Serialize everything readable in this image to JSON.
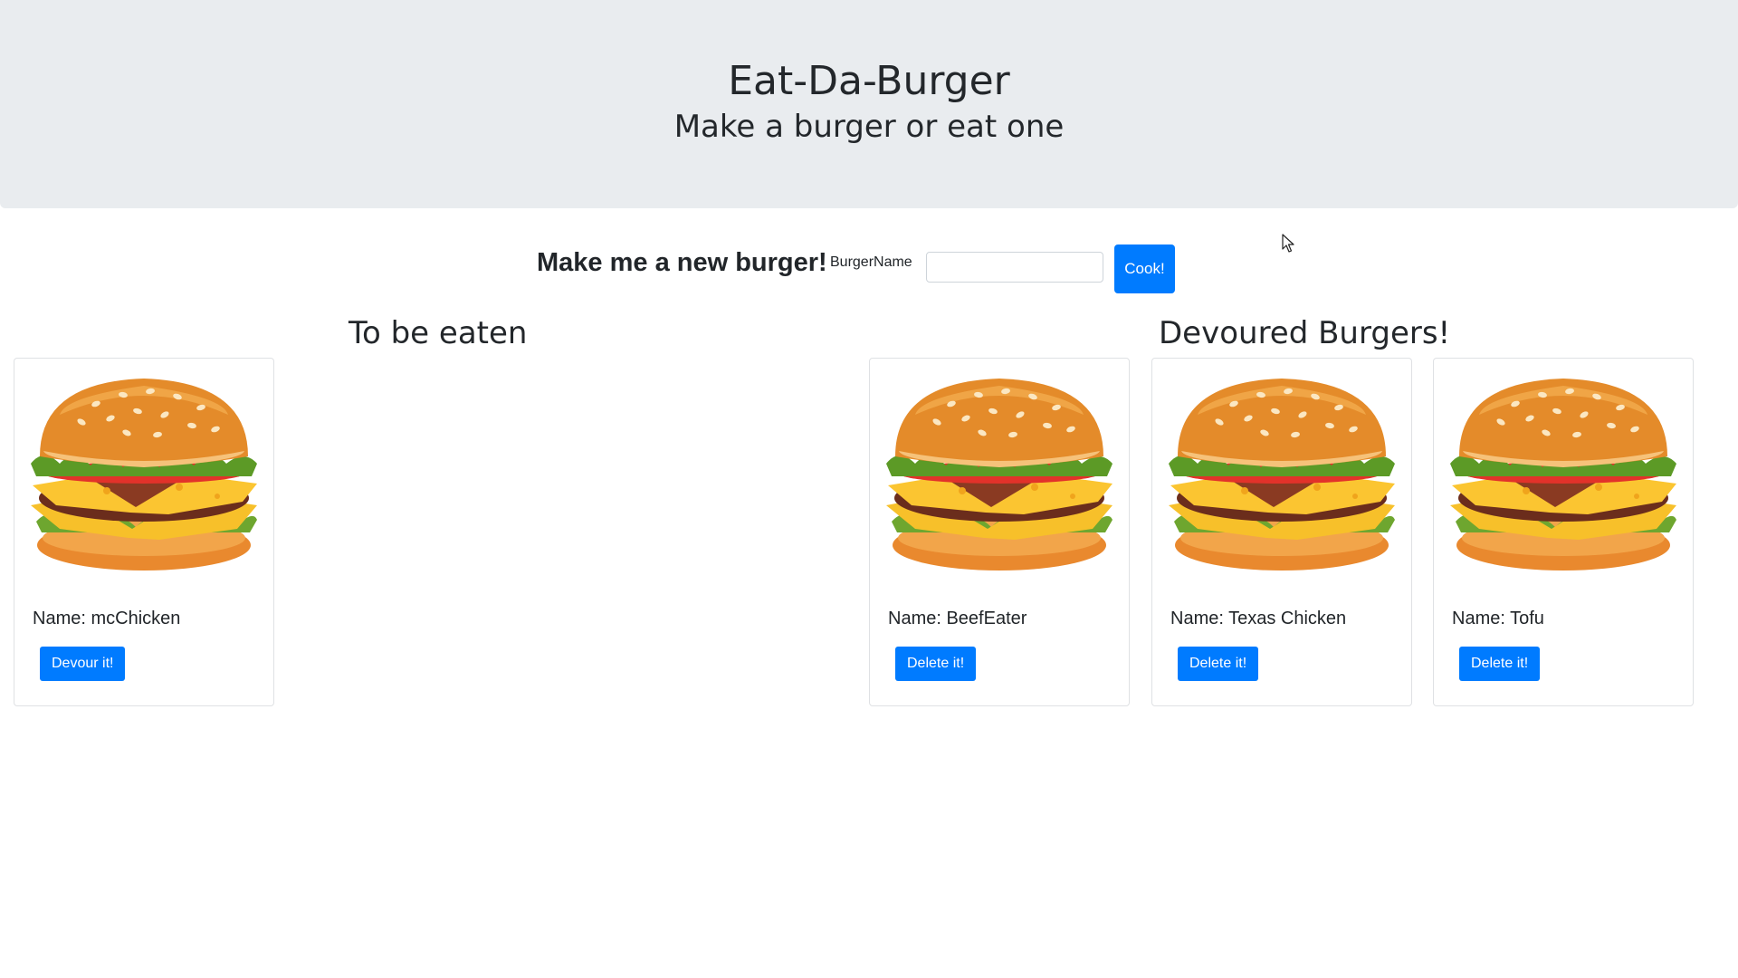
{
  "header": {
    "title": "Eat-Da-Burger",
    "subtitle": "Make a burger or eat one"
  },
  "form": {
    "heading": "Make me a new burger!",
    "label": "BurgerName",
    "input_value": "",
    "submit_label": "Cook!"
  },
  "sections": {
    "uneaten_title": "To be eaten",
    "devoured_title": "Devoured Burgers!"
  },
  "uneaten": [
    {
      "name": "Name: mcChicken",
      "button": "Devour it!"
    }
  ],
  "devoured": [
    {
      "name": "Name: BeefEater",
      "button": "Delete it!"
    },
    {
      "name": "Name: Texas Chicken",
      "button": "Delete it!"
    },
    {
      "name": "Name: Tofu",
      "button": "Delete it!"
    }
  ],
  "colors": {
    "primary": "#007bff",
    "jumbotron": "#e9ecef"
  },
  "icons": {
    "card_image": "burger-icon",
    "pointer": "cursor-arrow-icon"
  }
}
